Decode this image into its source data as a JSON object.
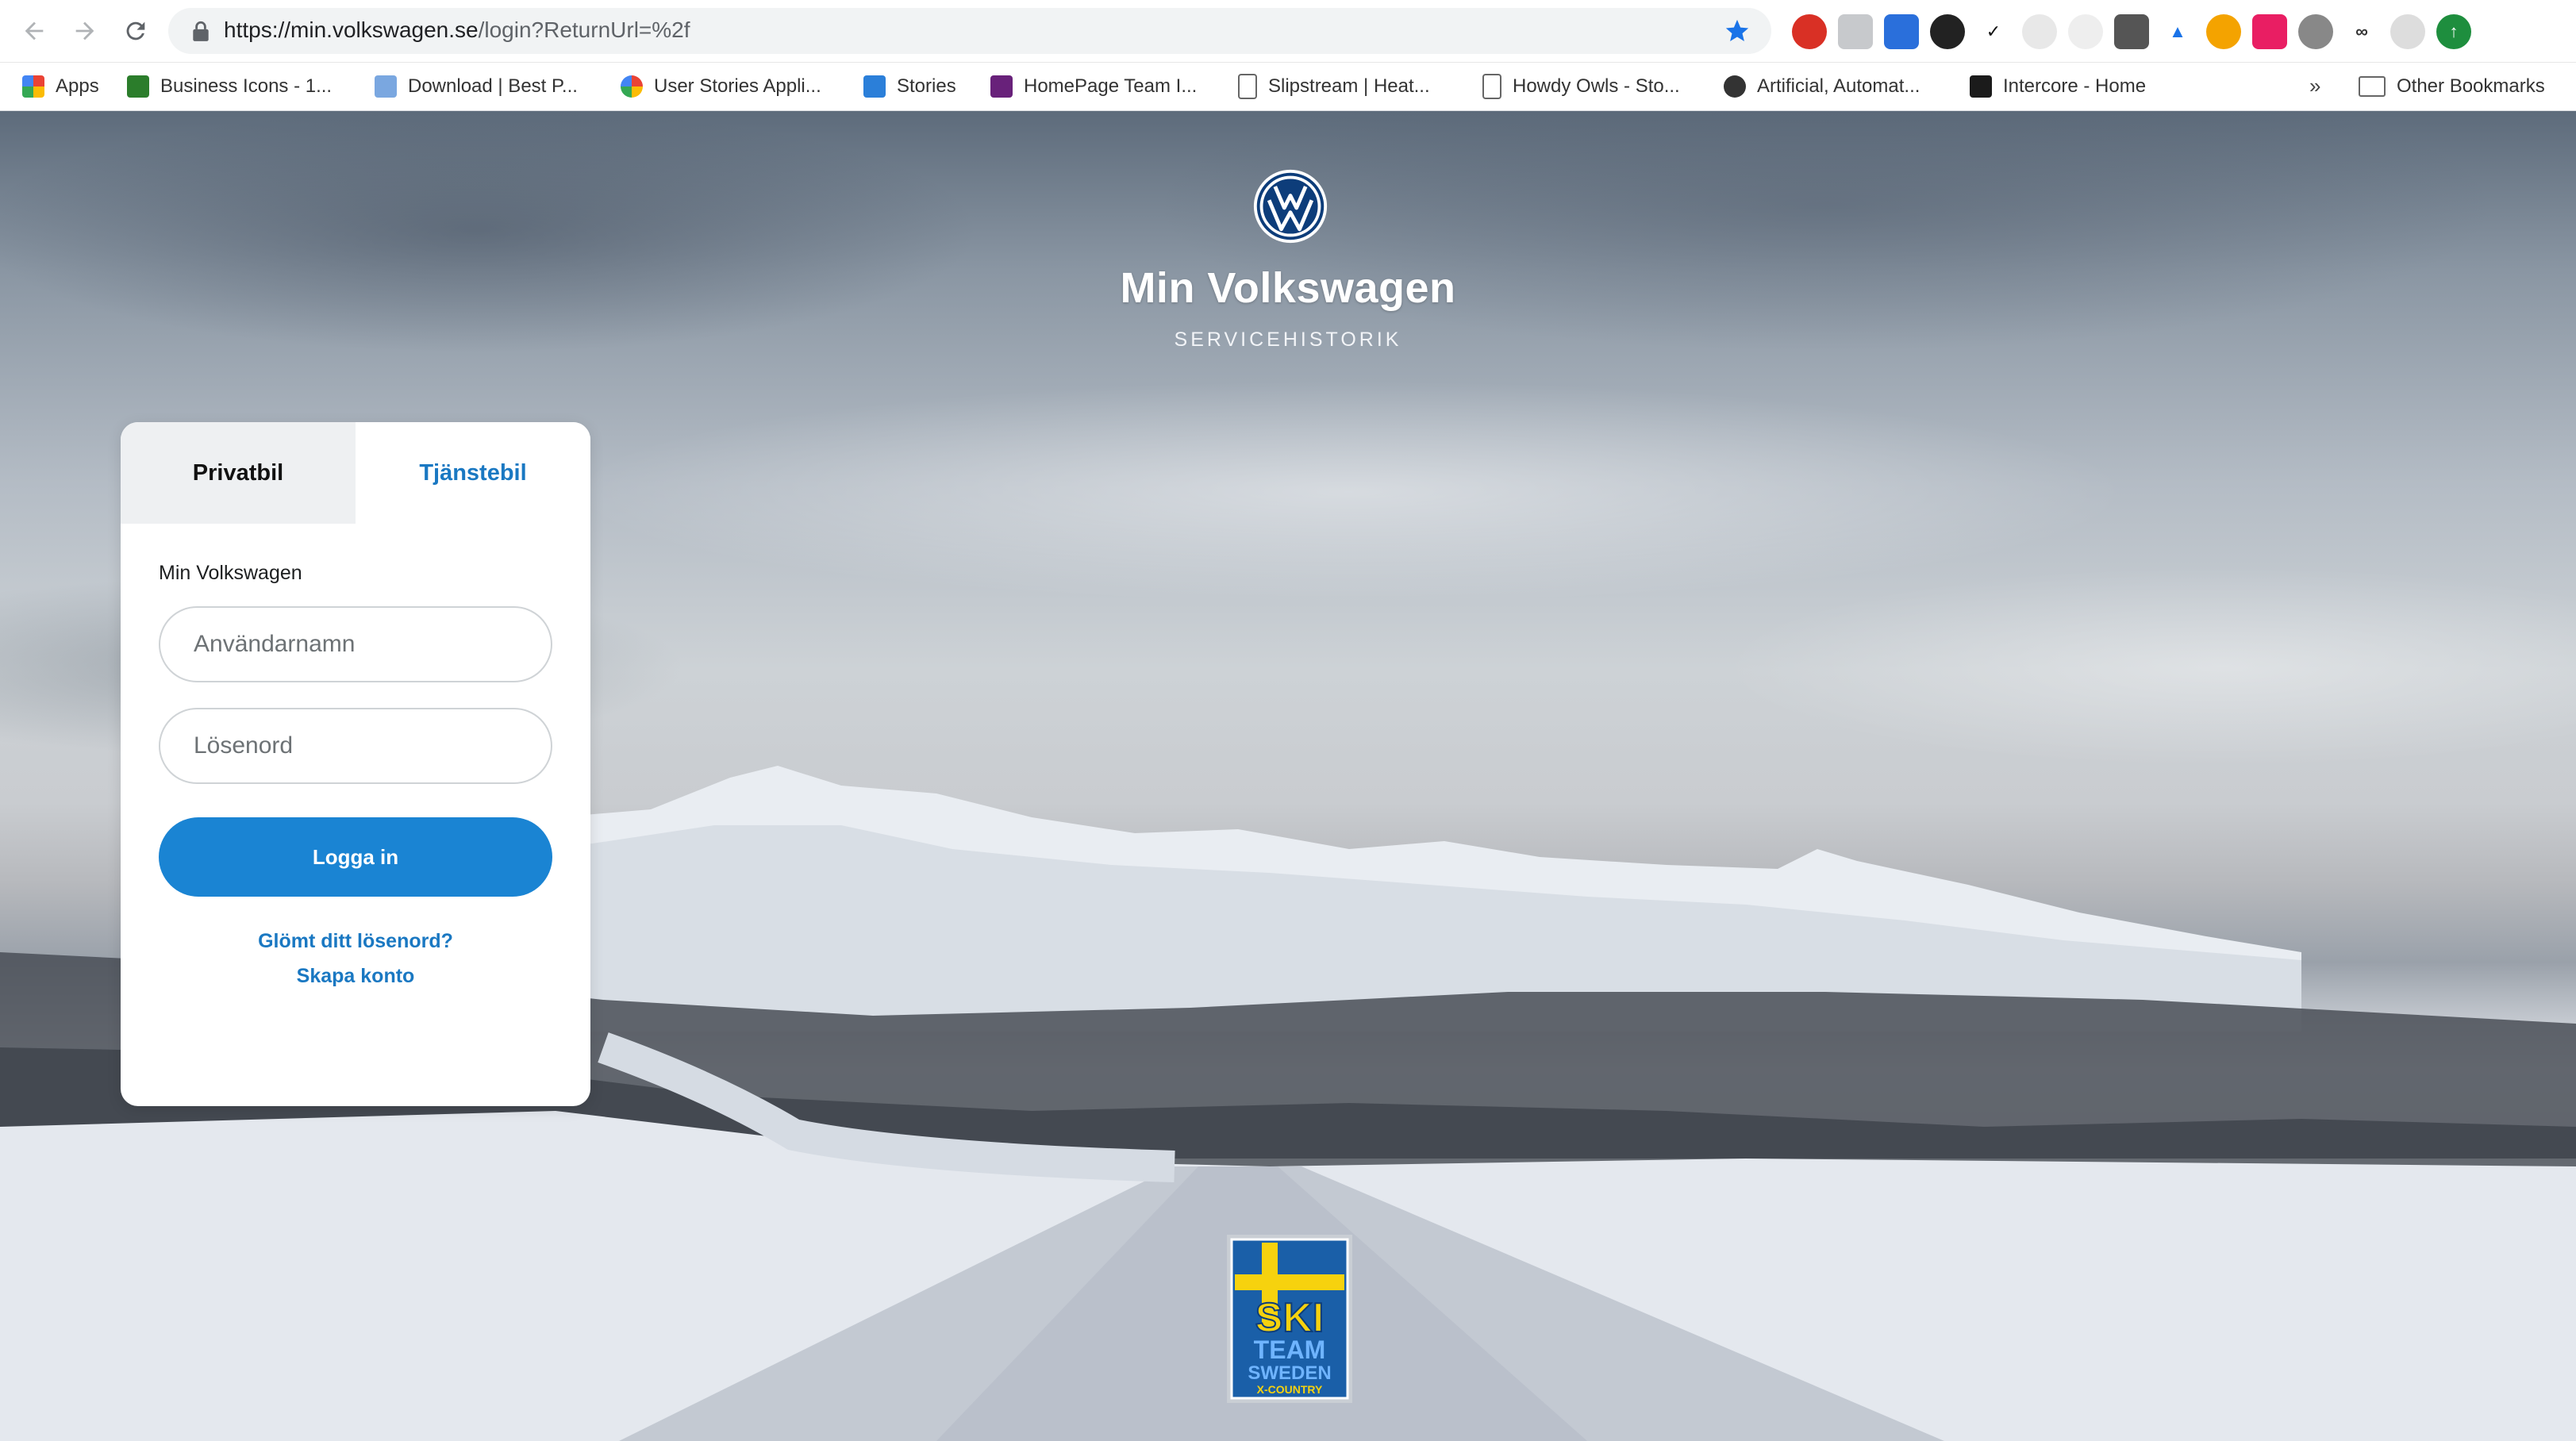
{
  "browser": {
    "url_host": "https://min.volkswagen.se",
    "url_path": "/login?ReturnUrl=%2f",
    "bookmarks": [
      {
        "label": "Apps",
        "icon": "apps-grid-icon"
      },
      {
        "label": "Business Icons - 1...",
        "icon": "business-icons-icon"
      },
      {
        "label": "Download | Best P...",
        "icon": "download-site-icon"
      },
      {
        "label": "User Stories Appli...",
        "icon": "google-icon"
      },
      {
        "label": "Stories",
        "icon": "stories-icon"
      },
      {
        "label": "HomePage Team I...",
        "icon": "visual-studio-icon"
      },
      {
        "label": "Slipstream | Heat...",
        "icon": "page-icon"
      },
      {
        "label": "Howdy Owls - Sto...",
        "icon": "page-icon"
      },
      {
        "label": "Artificial, Automat...",
        "icon": "artificial-icon"
      },
      {
        "label": "Intercore - Home",
        "icon": "intercore-icon"
      }
    ],
    "more_bookmarks": "»",
    "other_bookmarks": "Other Bookmarks"
  },
  "header": {
    "title": "Min Volkswagen",
    "subtitle": "SERVICEHISTORIK"
  },
  "login": {
    "tabs": [
      {
        "label": "Privatbil",
        "active": true
      },
      {
        "label": "Tjänstebil",
        "active": false
      }
    ],
    "section_label": "Min Volkswagen",
    "username_placeholder": "Användarnamn",
    "password_placeholder": "Lösenord",
    "submit_label": "Logga in",
    "forgot_link": "Glömt ditt lösenord?",
    "create_link": "Skapa konto"
  },
  "badge": {
    "line1": "SKI",
    "line2": "TEAM",
    "line3": "SWEDEN",
    "line4": "X-COUNTRY"
  },
  "colors": {
    "accent": "#1a84d3",
    "link": "#1a78c2",
    "vw_blue": "#0d3d7a"
  }
}
